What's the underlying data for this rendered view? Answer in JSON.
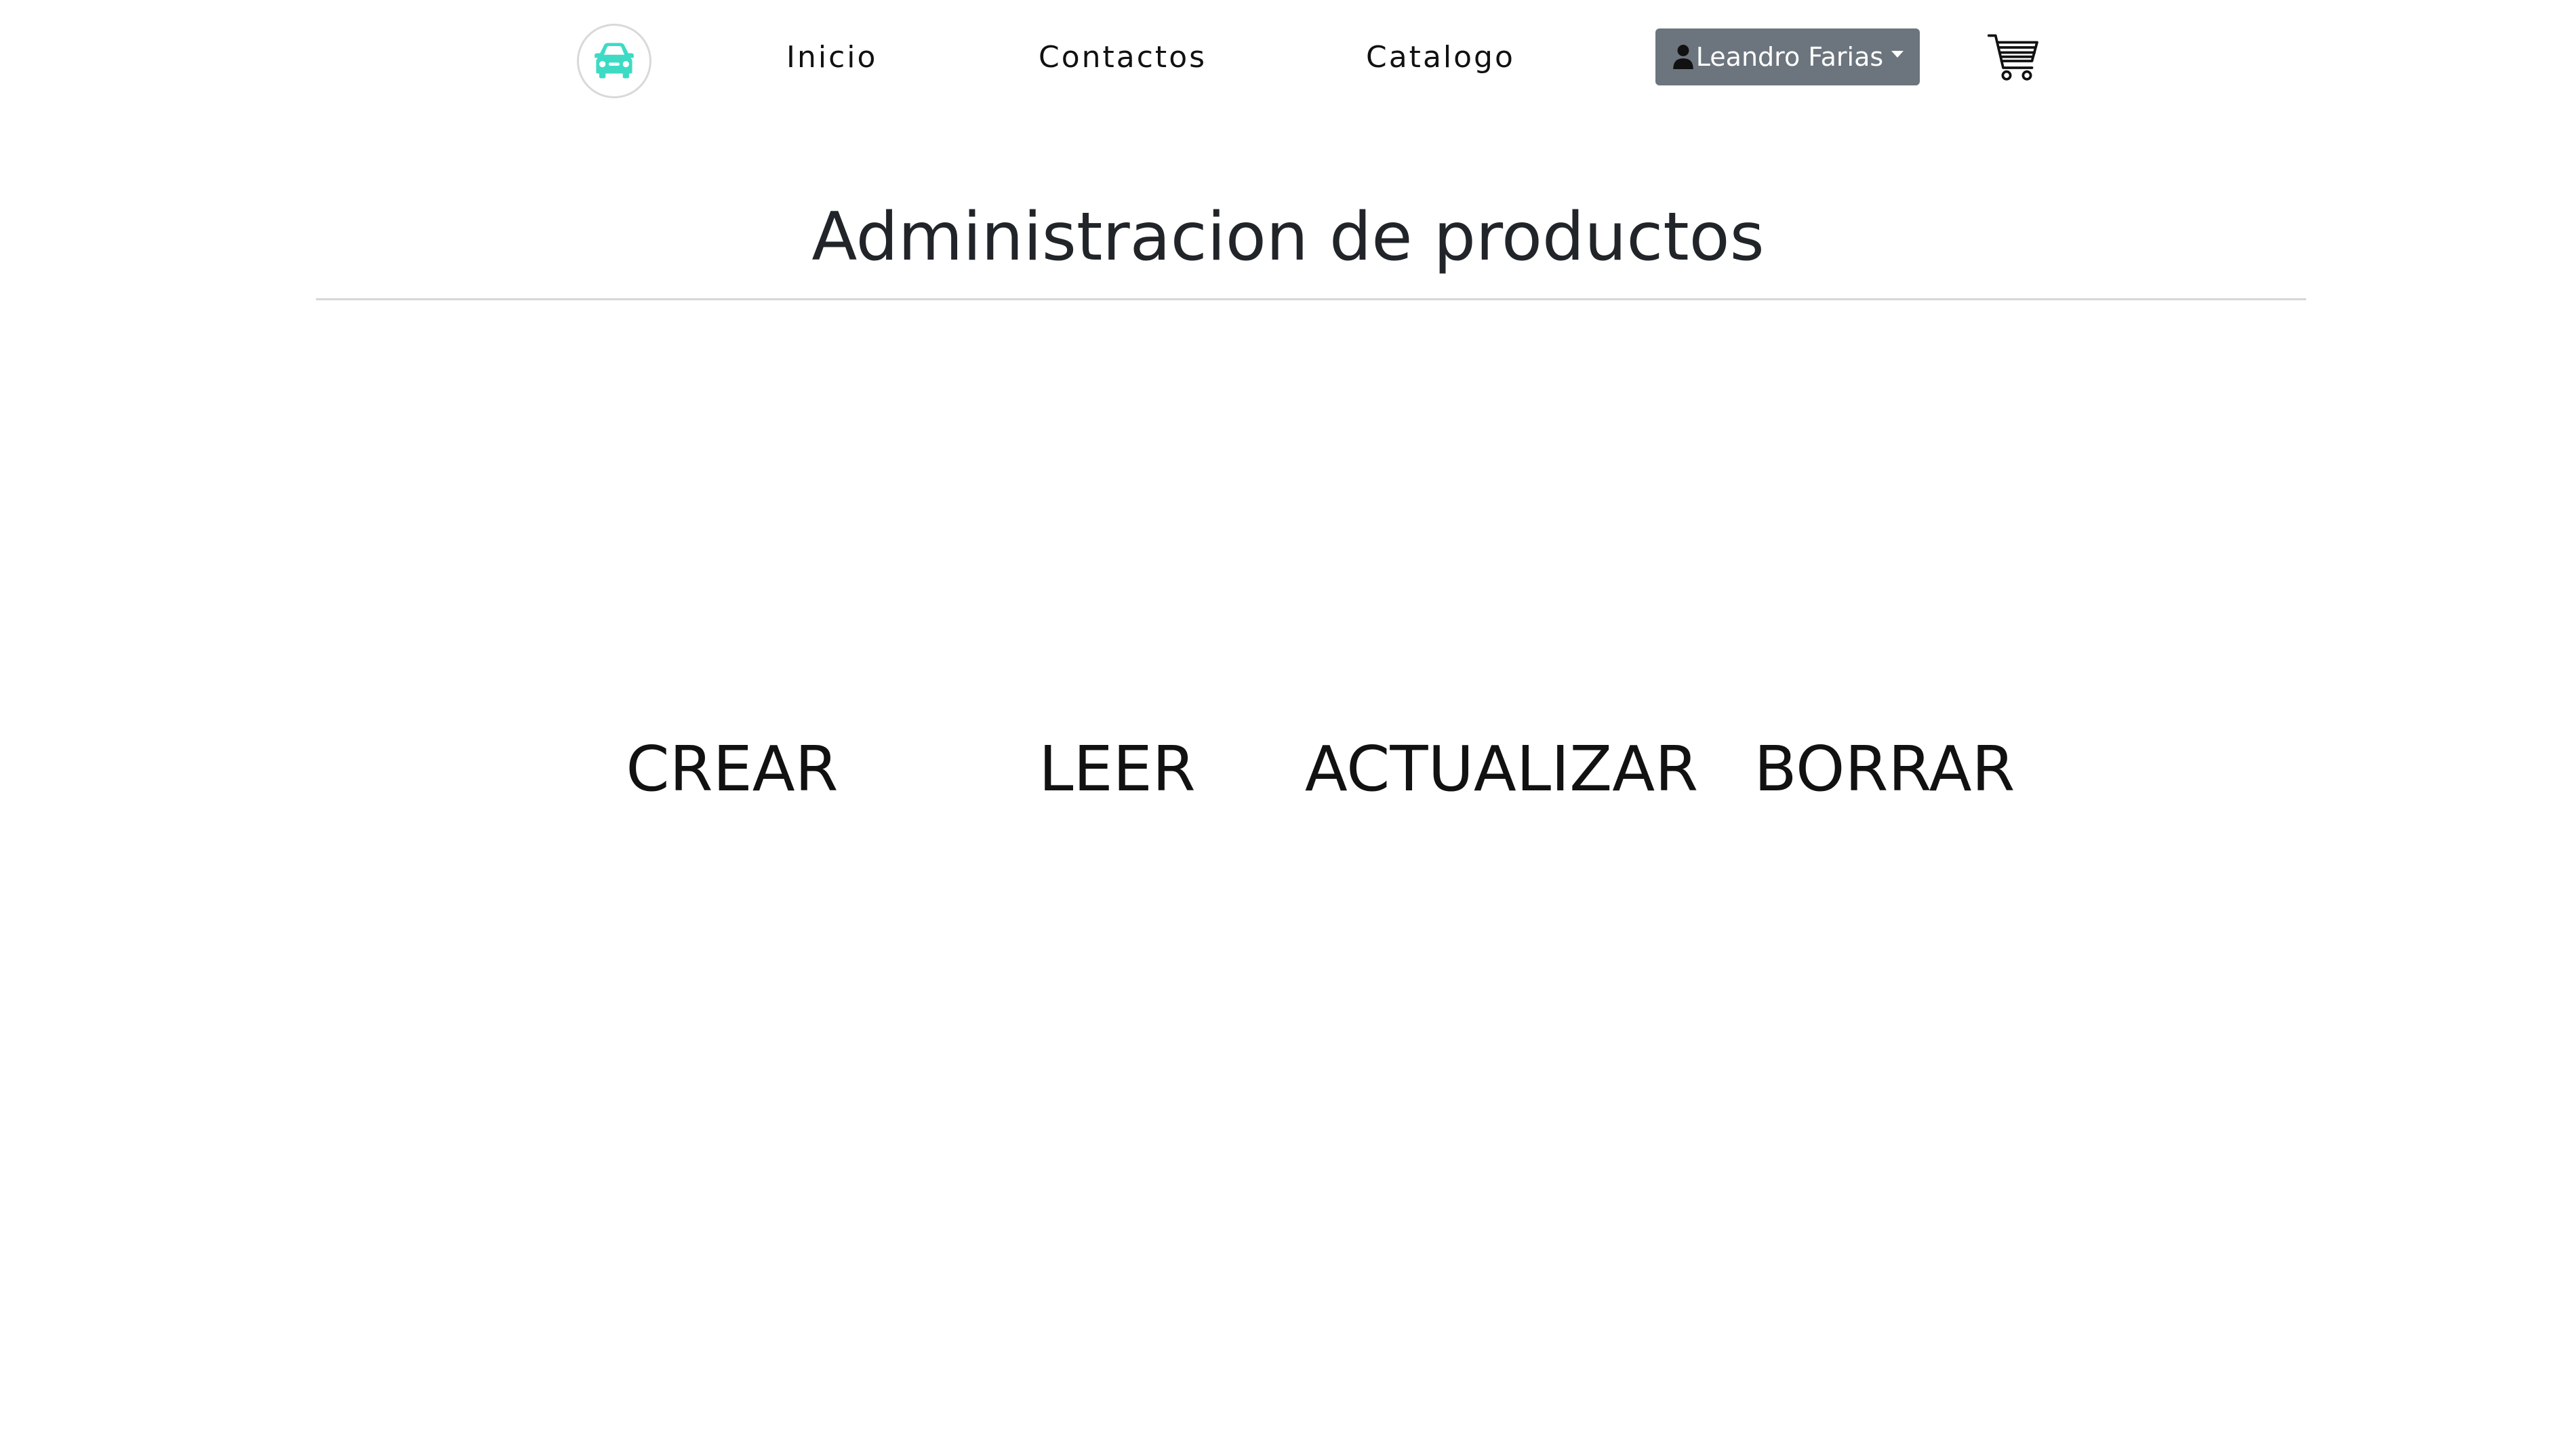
{
  "navbar": {
    "logo_icon": "car-icon",
    "logo_color": "#3ddbc4",
    "links": [
      {
        "label": "Inicio"
      },
      {
        "label": "Contactos"
      },
      {
        "label": "Catalogo"
      }
    ],
    "user_menu": {
      "icon": "user-icon",
      "label": "Leandro Farias",
      "background": "#6c757d"
    },
    "cart_icon": "shopping-cart-icon"
  },
  "main": {
    "title": "Administracion de productos",
    "actions": [
      {
        "label": "CREAR"
      },
      {
        "label": "LEER"
      },
      {
        "label": "ACTUALIZAR"
      },
      {
        "label": "BORRAR"
      }
    ]
  }
}
